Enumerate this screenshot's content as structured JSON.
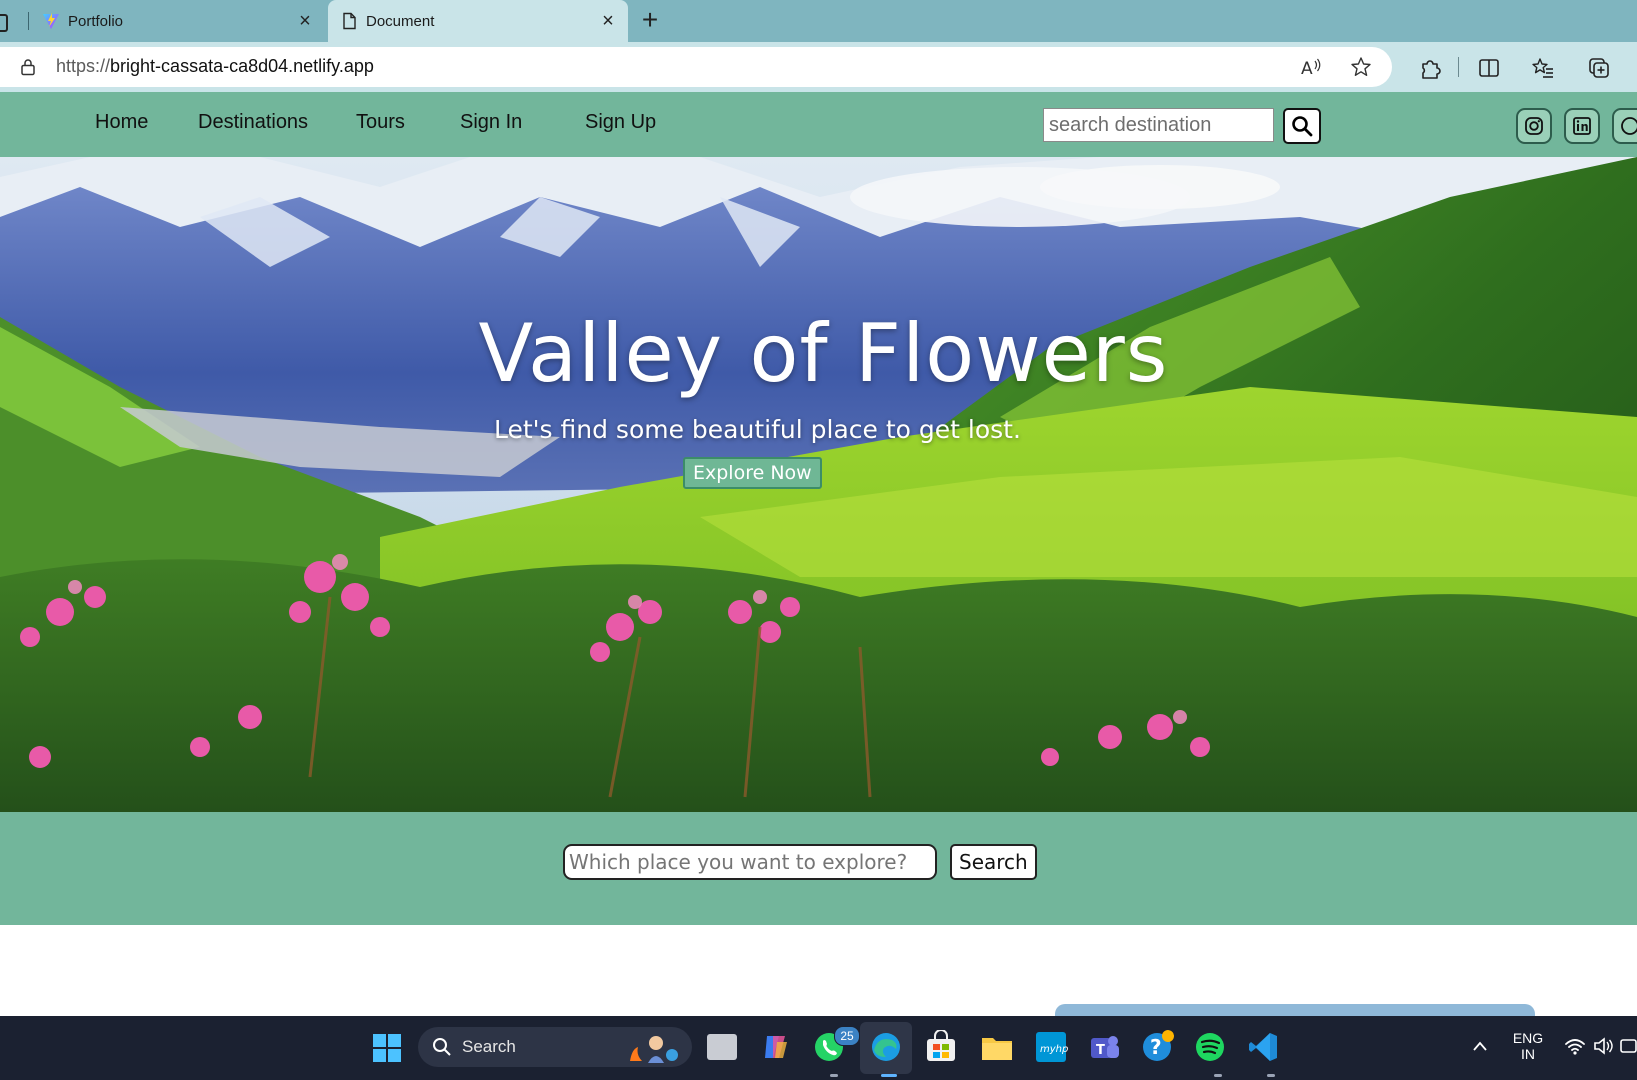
{
  "browser": {
    "tabs": [
      {
        "title": "Portfolio",
        "active": false
      },
      {
        "title": "Document",
        "active": true
      }
    ],
    "url_scheme": "https://",
    "url_host": "bright-cassata-ca8d04.netlify.app"
  },
  "nav": {
    "links": [
      "Home",
      "Destinations",
      "Tours",
      "Sign In",
      "Sign Up"
    ],
    "search_placeholder": "search destination",
    "social": [
      "instagram-icon",
      "linkedin-icon",
      "github-icon"
    ]
  },
  "hero": {
    "title": "Valley of Flowers",
    "subtitle": "Let's find some beautiful place to get lost.",
    "cta": "Explore Now"
  },
  "explore": {
    "placeholder": "Which place you want to explore?",
    "button": "Search"
  },
  "taskbar": {
    "search_label": "Search",
    "whatsapp_badge": "25",
    "lang_line1": "ENG",
    "lang_line2": "IN"
  },
  "colors": {
    "site_green": "#72b69b",
    "tab_strip": "#7fb5bf",
    "taskbar": "#1b2131"
  }
}
